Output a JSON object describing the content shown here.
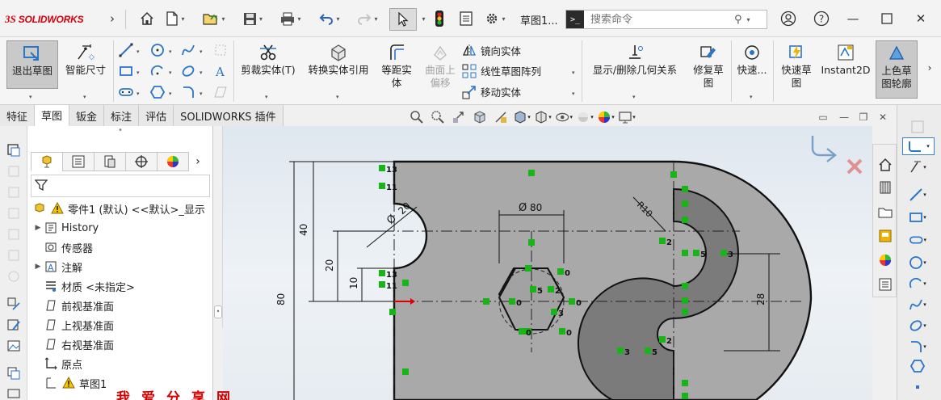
{
  "app": {
    "logo_ds": "3S",
    "logo_text": "SOLIDWORKS",
    "doc_title": "草图1...",
    "search_placeholder": "搜索命令"
  },
  "ribbon": {
    "exit_sketch": "退出草图",
    "smart_dimension": "智能尺寸",
    "trim_entities": "剪裁实体(T)",
    "convert_entities": "转换实体引用",
    "offset_line1": "等距实",
    "offset_line2": "体",
    "offset_surface_line1": "曲面上",
    "offset_surface_line2": "偏移",
    "mirror_entities": "镜向实体",
    "linear_pattern": "线性草图阵列",
    "move_entities": "移动实体",
    "display_relations": "显示/删除几何关系",
    "repair_line1": "修复草",
    "repair_line2": "图",
    "quick_snaps": "快速...",
    "rapid_sketch_line1": "快速草",
    "rapid_sketch_line2": "图",
    "instant2d": "Instant2D",
    "shaded_line1": "上色草",
    "shaded_line2": "图轮廓"
  },
  "tabs": [
    {
      "label": "特征"
    },
    {
      "label": "草图"
    },
    {
      "label": "钣金"
    },
    {
      "label": "标注"
    },
    {
      "label": "评估"
    },
    {
      "label": "SOLIDWORKS 插件"
    }
  ],
  "tree": {
    "root": "零件1 (默认) <<默认>_显示",
    "items": [
      {
        "label": "History"
      },
      {
        "label": "传感器"
      },
      {
        "label": "注解"
      },
      {
        "label": "材质 <未指定>"
      },
      {
        "label": "前视基准面"
      },
      {
        "label": "上视基准面"
      },
      {
        "label": "右视基准面"
      },
      {
        "label": "原点"
      },
      {
        "label": "草图1"
      }
    ]
  },
  "drawing": {
    "dim_diameter_20": "20",
    "dim_diameter_80": "80",
    "dim_radius_10": "R10",
    "dim_40": "40",
    "dim_20": "20",
    "dim_10": "10",
    "dim_80": "80",
    "dim_28": "28",
    "tags": [
      "13",
      "11",
      "13",
      "11",
      "0",
      "5",
      "2",
      "3",
      "0",
      "0",
      "0",
      "0",
      "2",
      "5",
      "3",
      "2",
      "3",
      "5",
      "2"
    ]
  },
  "watermark": "我爱分享网",
  "colors": {
    "part_fill": "#a9a9a9",
    "slot_fill": "#7b7b7b",
    "relation_tag": "#1ab31a",
    "accent": "#d4000d"
  }
}
